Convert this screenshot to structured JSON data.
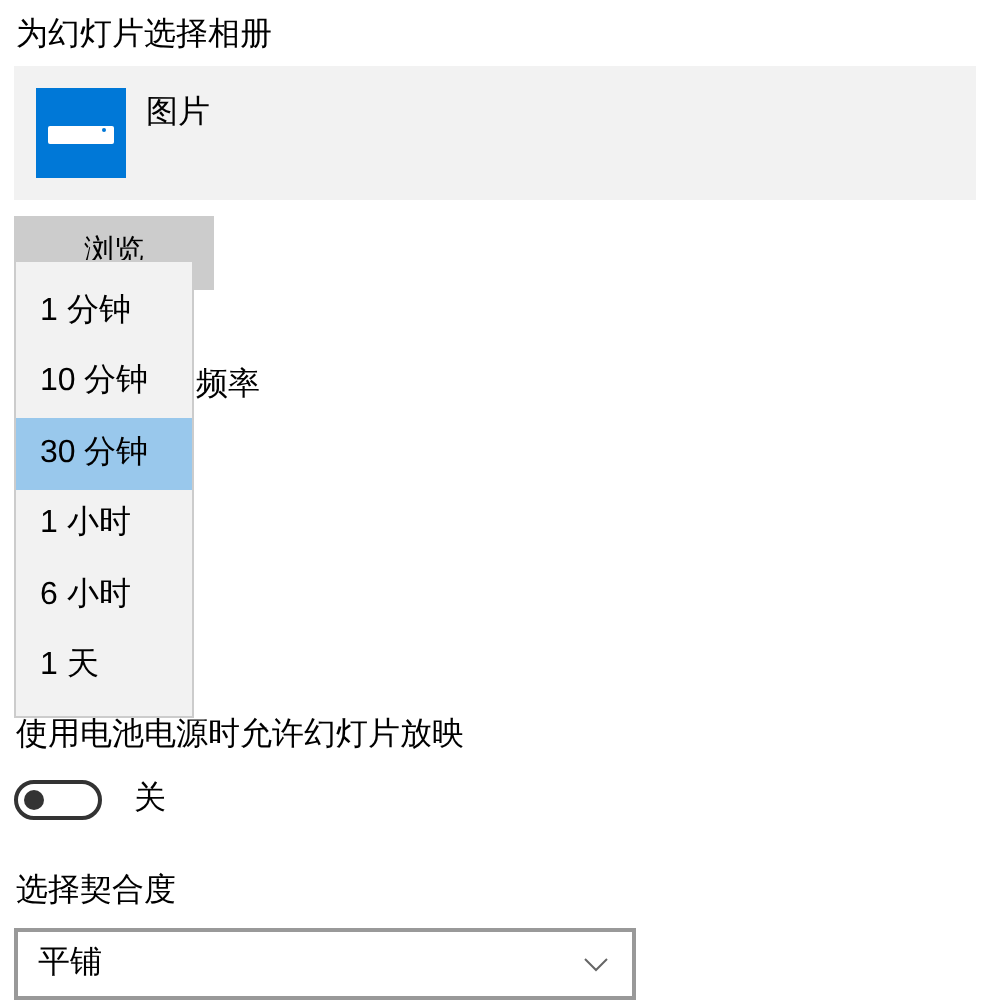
{
  "section_title": "为幻灯片选择相册",
  "album": {
    "name": "图片"
  },
  "browse_button": "浏览",
  "frequency": {
    "label": "频率",
    "options": [
      {
        "label": "1 分钟",
        "selected": false
      },
      {
        "label": "10 分钟",
        "selected": false
      },
      {
        "label": "30 分钟",
        "selected": true
      },
      {
        "label": "1 小时",
        "selected": false
      },
      {
        "label": "6 小时",
        "selected": false
      },
      {
        "label": "1 天",
        "selected": false
      }
    ]
  },
  "battery": {
    "label": "使用电池电源时允许幻灯片放映",
    "on": false,
    "state_text": "关"
  },
  "fit": {
    "label": "选择契合度",
    "value": "平铺"
  }
}
